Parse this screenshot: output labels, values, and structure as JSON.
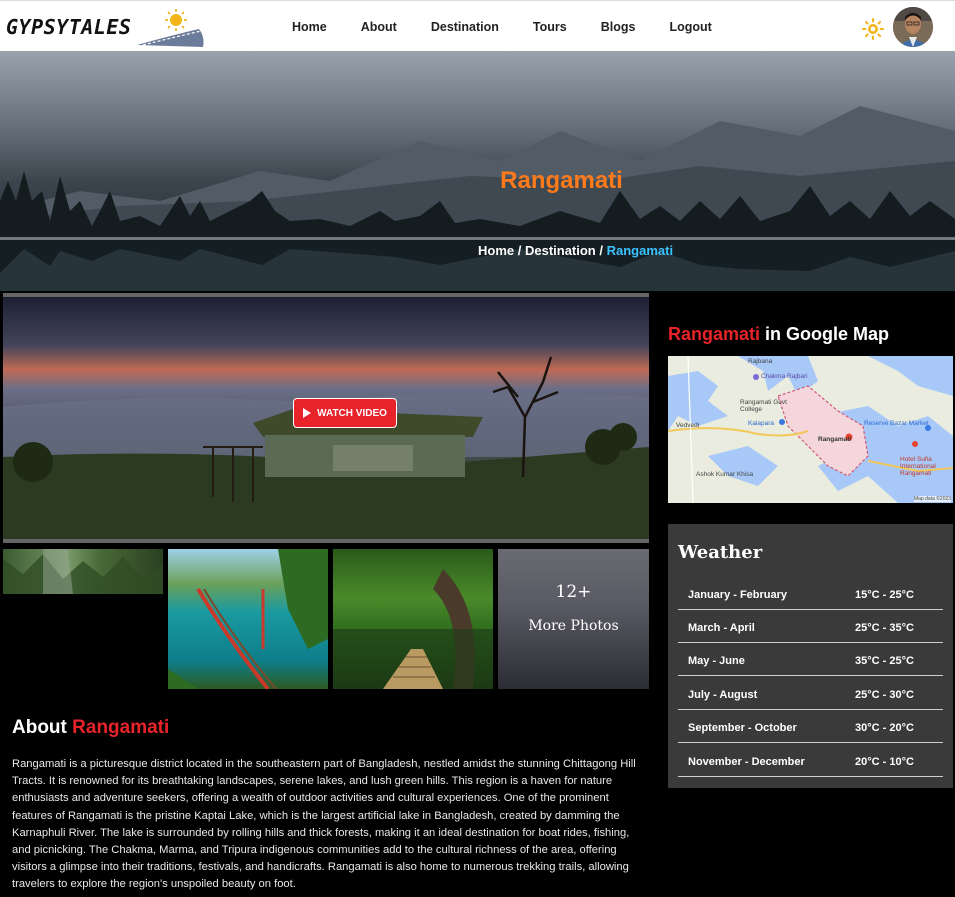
{
  "brand": {
    "name": "GYPSYTALES"
  },
  "nav": {
    "items": [
      {
        "label": "Home"
      },
      {
        "label": "About"
      },
      {
        "label": "Destination"
      },
      {
        "label": "Tours"
      },
      {
        "label": "Blogs"
      },
      {
        "label": "Logout"
      }
    ]
  },
  "hero": {
    "title": "Rangamati",
    "breadcrumb": {
      "home": "Home",
      "sep1": " / ",
      "destination": "Destination",
      "sep2": " / ",
      "current": "Rangamati"
    }
  },
  "video": {
    "button_label": "WATCH VIDEO"
  },
  "gallery": {
    "more_count": "12+",
    "more_label": "More Photos"
  },
  "about": {
    "title_prefix": "About ",
    "title_highlight": "Rangamati",
    "text": "Rangamati is a picturesque district located in the southeastern part of Bangladesh, nestled amidst the stunning Chittagong Hill Tracts. It is renowned for its breathtaking landscapes, serene lakes, and lush green hills. This region is a haven for nature enthusiasts and adventure seekers, offering a wealth of outdoor activities and cultural experiences. One of the prominent features of Rangamati is the pristine Kaptai Lake, which is the largest artificial lake in Bangladesh, created by damming the Karnaphuli River. The lake is surrounded by rolling hills and thick forests, making it an ideal destination for boat rides, fishing, and picnicking. The Chakma, Marma, and Tripura indigenous communities add to the cultural richness of the area, offering visitors a glimpse into their traditions, festivals, and handicrafts. Rangamati is also home to numerous trekking trails, allowing travelers to explore the region's unspoiled beauty on foot."
  },
  "map": {
    "title_highlight": "Rangamati",
    "title_suffix": " in Google Map",
    "labels": {
      "rajbana": "Rajbana",
      "chakma_rajbari": "Chakma Rajbari",
      "govt_college": "Rangamati Govt College",
      "vedvedi": "Vedvedi",
      "kalapara": "Kalapara",
      "city": "Rangamati",
      "bazar": "Reserve Bazar Market",
      "hotel": "Hotel Sufia International Rangamati",
      "ashok": "Ashok Kumar Khisa",
      "map_data": "Map data ©2023"
    }
  },
  "weather": {
    "title": "Weather",
    "rows": [
      {
        "months": "January - February",
        "temp": "15°C - 25°C"
      },
      {
        "months": "March - April",
        "temp": "25°C - 35°C"
      },
      {
        "months": "May - June",
        "temp": "35°C - 25°C"
      },
      {
        "months": "July - August",
        "temp": "25°C - 30°C"
      },
      {
        "months": "September - October",
        "temp": "30°C - 20°C"
      },
      {
        "months": "November - December",
        "temp": "20°C - 10°C"
      }
    ]
  },
  "colors": {
    "accent_red": "#e8232a",
    "hero_title": "#ff7a1a",
    "breadcrumb_current": "#3bc3ff",
    "panel_bg": "#3a3a3a"
  },
  "icons": {
    "toggle": "sun-icon",
    "play": "play-icon"
  }
}
